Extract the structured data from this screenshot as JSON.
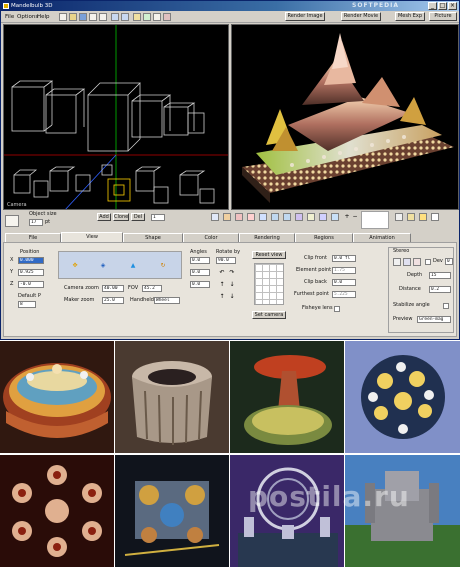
{
  "window": {
    "title": "Mandelbulb 3D",
    "watermark": "SOFTPEDIA"
  },
  "menu": {
    "items": [
      "File",
      "Options",
      "Help"
    ]
  },
  "toolbar": {
    "buttons": [
      "Render Image",
      "Render Movie",
      "Mesh Exp",
      "Picture"
    ]
  },
  "viewports": {
    "wire_label": "Camera"
  },
  "panel": {
    "object_size_label": "Object size",
    "object_size_value": "17",
    "object_size_unit": "pt",
    "add_button": "Add",
    "clone_button": "Clone",
    "del_button": "Del",
    "edit_value": "1",
    "tabs": [
      "File",
      "View",
      "Shape",
      "Color",
      "Rendering",
      "Regions",
      "Animation"
    ],
    "position_label": "Position",
    "x_value": "0.000",
    "y_value": "0.925",
    "z_value": "-0.0",
    "default_p_label": "Default P",
    "default_p_value": "8",
    "camera_zoom_label": "Camera zoom",
    "camera_zoom_value": "40.00",
    "fov_label": "FOV",
    "fov_value": "45.2",
    "maker_zoom_label": "Maker zoom",
    "maker_zoom_value": "25.0",
    "handheld_label": "Handheld",
    "handheld_value": "Wheel",
    "angles_label": "Angles",
    "rotate_by_label": "Rotate by",
    "angle_a_value": "0.0",
    "angle_b_value": "0.0",
    "angle_c_value": "0.0",
    "rotate_value": "90.0",
    "reset_view_button": "Reset view",
    "set_camera_button": "Set camera",
    "clip_front_label": "Clip front",
    "clip_front_value": "0.0 fl",
    "element_point_label": "Element point",
    "element_point_value": "1.75",
    "clip_back_label": "Clip back",
    "clip_back_value": "0.0",
    "furthest_point_label": "Furthest point",
    "furthest_point_value": "5.225",
    "fisheye_label": "Fisheye lens",
    "stereo_label": "Stereo",
    "dev_label": "Dev",
    "dev_value": "0",
    "depth_label": "Depth",
    "depth_value": "15",
    "distance_label": "Distance",
    "distance_value": "0.2",
    "stabilize_label": "Stabilize angle",
    "preview_label": "Preview",
    "preview_value": "Green-mag"
  },
  "colors": {
    "window_bg": "#d4d0c8",
    "title_start": "#0a246a",
    "title_end": "#a6caf0",
    "field_highlight": "#316ac5"
  }
}
